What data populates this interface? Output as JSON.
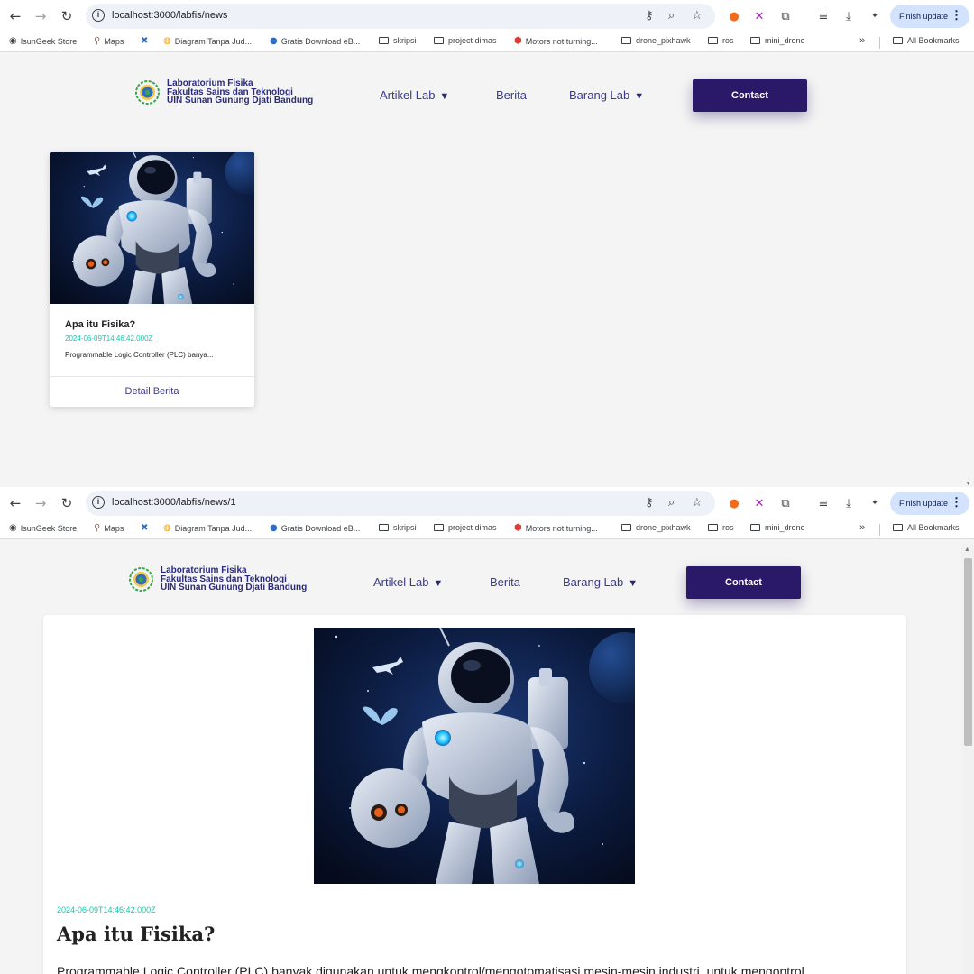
{
  "browser": {
    "finish_update_label": "Finish update",
    "all_bookmarks_label": "All Bookmarks",
    "bookmarks": [
      {
        "label": "IsunGeek Store",
        "icon": "globe-icon"
      },
      {
        "label": "Maps",
        "icon": "maps-pin-icon"
      },
      {
        "label": "",
        "icon": "x-extension-icon"
      },
      {
        "label": "Diagram Tanpa Jud...",
        "icon": "diagram-icon"
      },
      {
        "label": "Gratis Download eB...",
        "icon": "globe-icon"
      },
      {
        "label": "skripsi",
        "icon": "folder-icon"
      },
      {
        "label": "project dimas",
        "icon": "folder-icon"
      },
      {
        "label": "Motors not turning...",
        "icon": "hexagon-icon"
      },
      {
        "label": "drone_pixhawk",
        "icon": "folder-icon"
      },
      {
        "label": "ros",
        "icon": "folder-icon"
      },
      {
        "label": "mini_drone",
        "icon": "folder-icon"
      }
    ]
  },
  "windows": [
    {
      "url": "localhost:3000/labfis/news"
    },
    {
      "url": "localhost:3000/labfis/news/1"
    }
  ],
  "site": {
    "logo_lines": [
      "Laboratorium Fisika",
      "Fakultas Sains dan Teknologi",
      "UIN Sunan Gunung Djati Bandung"
    ],
    "nav": {
      "artikel_lab": "Artikel Lab",
      "berita": "Berita",
      "barang_lab": "Barang Lab",
      "caret": "▼"
    },
    "contact_label": "Contact"
  },
  "news_list": {
    "card": {
      "title": "Apa itu Fisika?",
      "date": "2024-06-09T14:46:42.000Z",
      "excerpt": "Programmable Logic Controller (PLC) banya...",
      "link_label": "Detail Berita"
    }
  },
  "news_detail": {
    "date": "2024-06-09T14:46:42.000Z",
    "title": "Apa itu Fisika?",
    "body": "Programmable Logic Controller (PLC) banyak digunakan untuk mengkontrol/mengotomatisasi mesin-mesin industri, untuk mengontrol"
  }
}
